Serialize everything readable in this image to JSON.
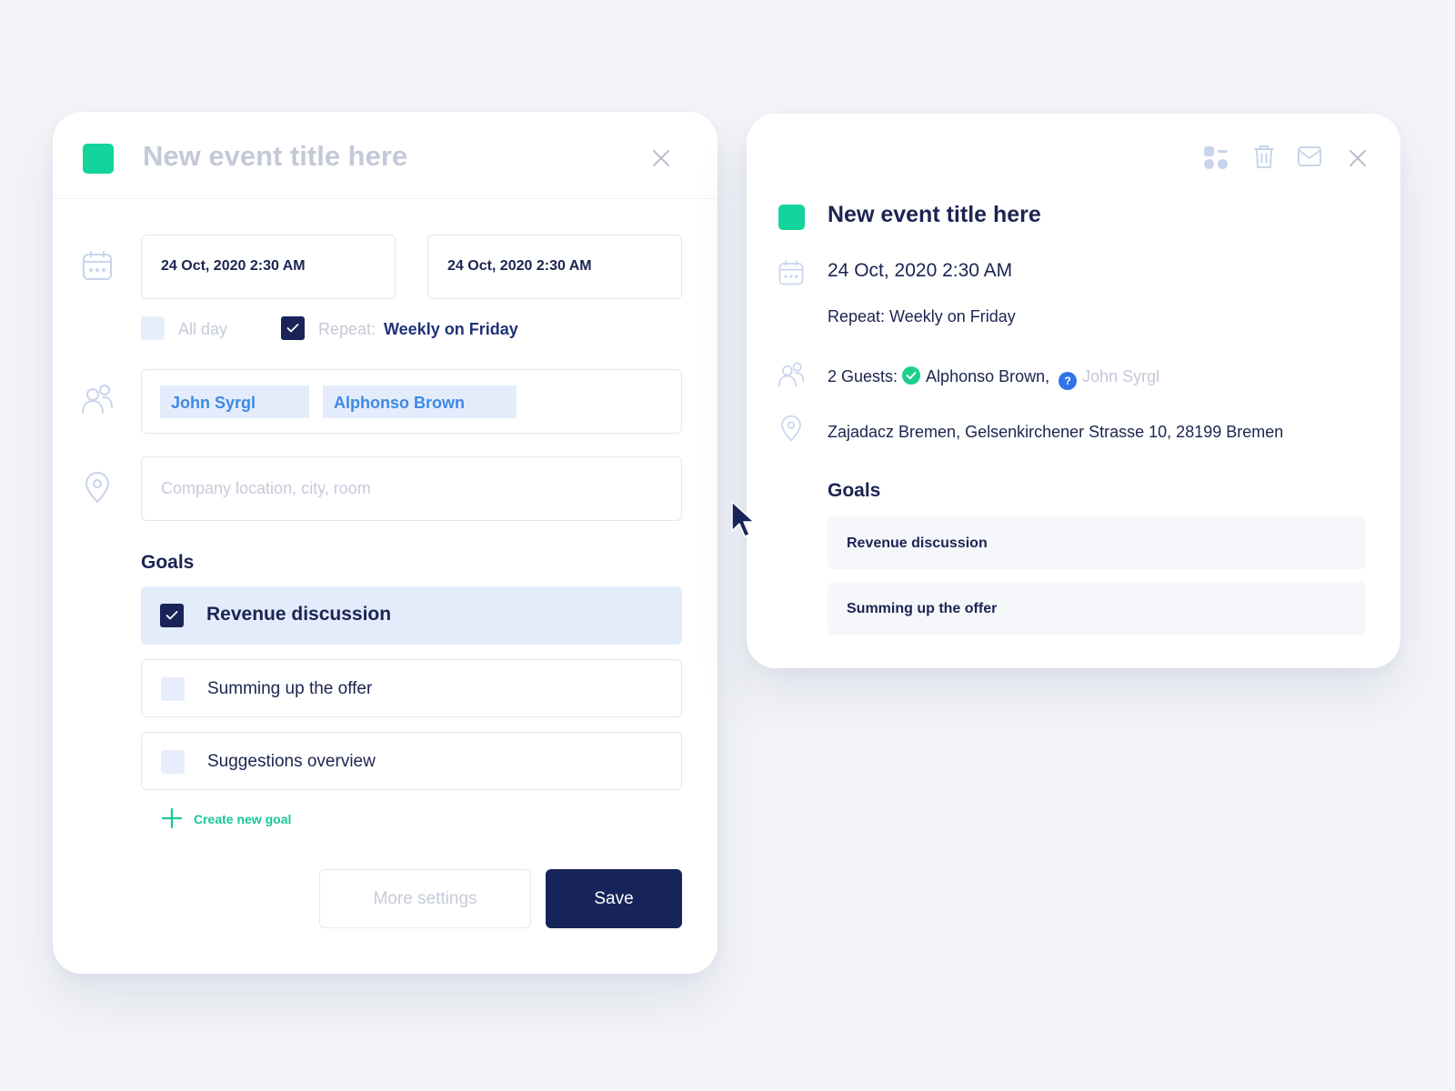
{
  "colors": {
    "event_color": "#13d49d",
    "primary_navy": "#17245a",
    "accent_green": "#18c79a",
    "chip_blue": "#3d89e6",
    "guest_accepted": "#1ccf8c",
    "guest_pending": "#2e74e8"
  },
  "editor": {
    "title_placeholder": "New event title here",
    "close_icon": "close-icon",
    "start_date": "24 Oct, 2020 2:30 AM",
    "end_date": "24 Oct, 2020 2:30 AM",
    "all_day": {
      "label": "All day",
      "checked": false
    },
    "repeat": {
      "prefix": "Repeat:",
      "value": "Weekly on Friday",
      "checked": true
    },
    "guests": [
      "John Syrgl",
      "Alphonso Brown"
    ],
    "location_placeholder": "Company location, city, room",
    "goals_heading": "Goals",
    "goals": [
      {
        "label": "Revenue discussion",
        "checked": true
      },
      {
        "label": "Summing up the offer",
        "checked": false
      },
      {
        "label": "Suggestions overview",
        "checked": false
      }
    ],
    "create_goal_label": "Create new goal",
    "more_settings_label": "More settings",
    "save_label": "Save"
  },
  "preview": {
    "toolbar_icons": [
      "layout-icon",
      "trash-icon",
      "mail-icon",
      "close-icon"
    ],
    "title": "New event title here",
    "date": "24 Oct, 2020 2:30 AM",
    "repeat": "Repeat: Weekly on Friday",
    "guests_label": "2 Guests:",
    "guests": [
      {
        "name": "Alphonso Brown,",
        "status": "accepted"
      },
      {
        "name": "John Syrgl",
        "status": "pending",
        "badge": "?"
      }
    ],
    "address": "Zajadacz Bremen, Gelsenkirchener Strasse 10, 28199 Bremen",
    "goals_heading": "Goals",
    "goals": [
      "Revenue discussion",
      "Summing up the offer"
    ]
  }
}
